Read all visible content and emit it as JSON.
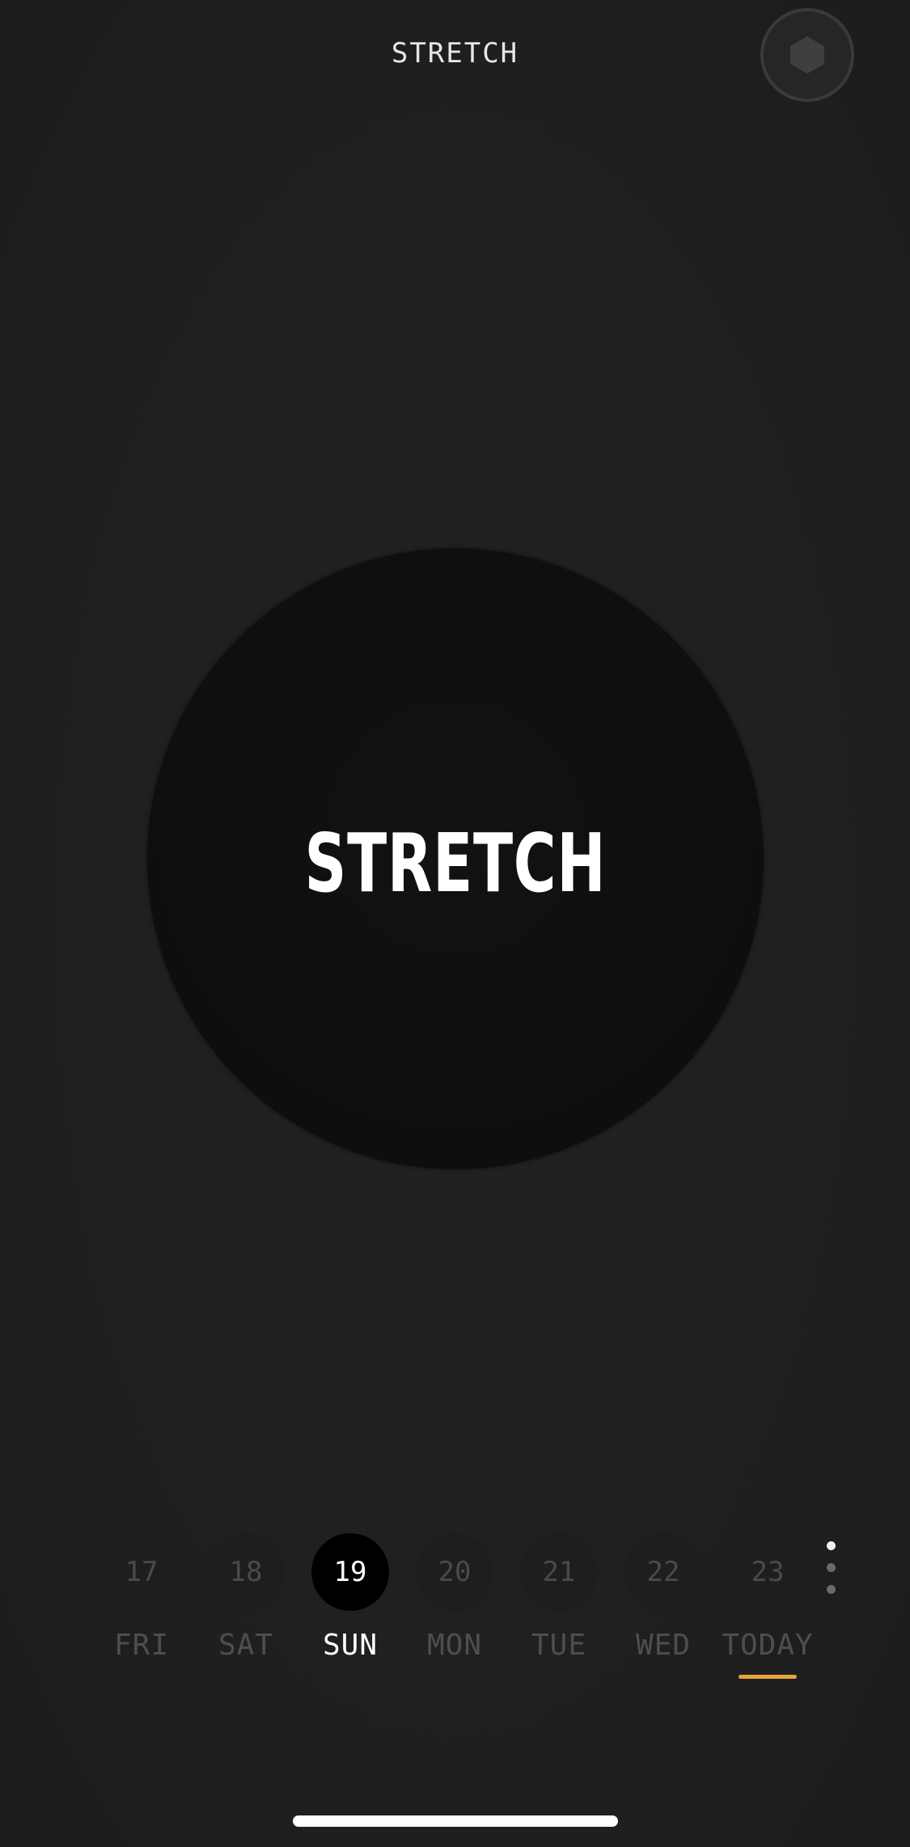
{
  "header": {
    "title": "STRETCH",
    "profile_icon": "hexagon-icon"
  },
  "main": {
    "button_label": "STRETCH"
  },
  "days": [
    {
      "number": "17",
      "name": "FRI"
    },
    {
      "number": "18",
      "name": "SAT"
    },
    {
      "number": "19",
      "name": "SUN",
      "selected": true
    },
    {
      "number": "20",
      "name": "MON"
    },
    {
      "number": "21",
      "name": "TUE"
    },
    {
      "number": "22",
      "name": "WED"
    },
    {
      "number": "23",
      "name": "TODAY",
      "today": true
    }
  ],
  "more_menu_icon": "vertical-dots-icon",
  "colors": {
    "background": "#202020",
    "circle": "#0f0f0f",
    "accent_today": "#e3a53b",
    "inactive_text": "#4e4e4e",
    "active_text": "#ffffff"
  }
}
